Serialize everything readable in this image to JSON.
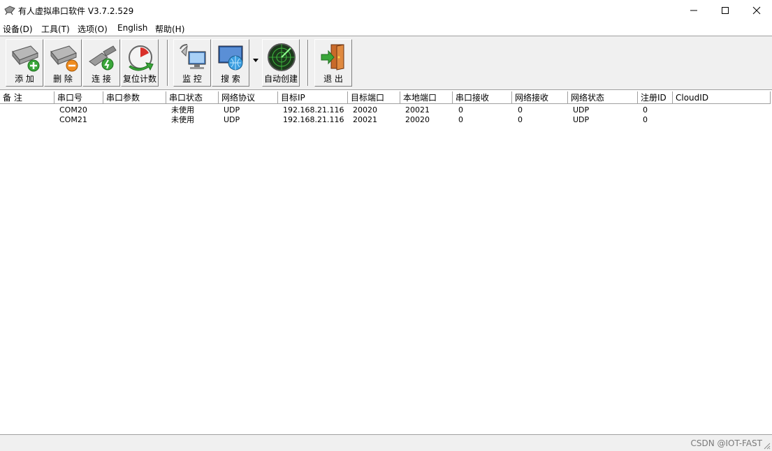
{
  "window": {
    "title": "有人虚拟串口软件 V3.7.2.529",
    "icon": "app-plug-icon",
    "controls": [
      "minimize-icon",
      "maximize-icon",
      "close-icon"
    ]
  },
  "menu": [
    {
      "label": "设备(D)"
    },
    {
      "label": "工具(T)"
    },
    {
      "label": "选项(O)"
    },
    {
      "label": "English"
    },
    {
      "label": "帮助(H)"
    }
  ],
  "toolbar": {
    "add": {
      "label": "添 加",
      "icon": "add-port-icon"
    },
    "delete": {
      "label": "删 除",
      "icon": "delete-port-icon"
    },
    "connect": {
      "label": "连 接",
      "icon": "connect-icon"
    },
    "reset": {
      "label": "复位计数",
      "icon": "reset-counter-icon"
    },
    "monitor": {
      "label": "监 控",
      "icon": "monitor-icon"
    },
    "search": {
      "label": "搜 索",
      "icon": "search-globe-icon"
    },
    "auto_create": {
      "label": "自动创建",
      "icon": "radar-icon"
    },
    "exit": {
      "label": "退 出",
      "icon": "exit-door-icon"
    }
  },
  "table": {
    "columns": [
      "备 注",
      "串口号",
      "串口参数",
      "串口状态",
      "网络协议",
      "目标IP",
      "目标端口",
      "本地端口",
      "串口接收",
      "网络接收",
      "网络状态",
      "注册ID",
      "CloudID"
    ],
    "rows": [
      [
        "",
        "COM20",
        "",
        "未使用",
        "UDP",
        "192.168.21.116",
        "20020",
        "20021",
        "0",
        "0",
        "UDP",
        "0",
        ""
      ],
      [
        "",
        "COM21",
        "",
        "未使用",
        "UDP",
        "192.168.21.116",
        "20021",
        "20020",
        "0",
        "0",
        "UDP",
        "0",
        ""
      ]
    ]
  },
  "status": {
    "watermark": "CSDN @IOT-FAST"
  }
}
